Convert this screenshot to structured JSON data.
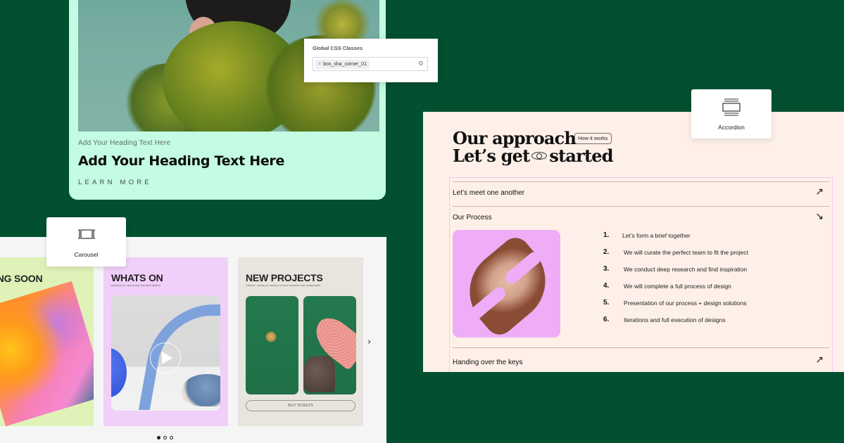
{
  "hero_card": {
    "subheading": "Add Your Heading Text Here",
    "heading": "Add Your Heading Text Here",
    "link": "LEARN MORE"
  },
  "css_classes_panel": {
    "label": "Global CSS Classes",
    "tags": [
      {
        "remove_icon": "×",
        "value": "box_sha_corner_01"
      }
    ],
    "settings_icon": "gear-icon"
  },
  "widgets": {
    "carousel": {
      "label": "Carousel",
      "icon": "carousel-icon"
    },
    "accordion": {
      "label": "Accordion",
      "icon": "accordion-icon"
    }
  },
  "carousel": {
    "slides": [
      {
        "title": "ING SOON"
      },
      {
        "title": "WHATS ON",
        "caption": "ENGAGE US • DISCOVER THE NEW DESIGN"
      },
      {
        "title": "NEW PROJECTS",
        "caption": "STREAM • PRODUCT DESIGN STUDIO REVIEWS AND INTERVIEWS",
        "button": "BUY TICKETS"
      }
    ],
    "next_label": "›",
    "dots": {
      "count": 3,
      "active": 0
    }
  },
  "approach": {
    "title_line1": "Our approach",
    "title_line2_a": "Let’s get",
    "title_line2_b": "started",
    "badge": "How it works",
    "accordion": [
      {
        "label": "Let’s meet one another",
        "arrow": "↗",
        "expanded": false
      },
      {
        "label": "Our Process",
        "arrow": "↘",
        "expanded": true
      },
      {
        "label": "Handing over the keys",
        "arrow": "↗",
        "expanded": false
      }
    ],
    "steps": [
      {
        "num": "1.",
        "text": "Let’s form a brief together"
      },
      {
        "num": "2.",
        "text": "We will curate the perfect team to fit the project"
      },
      {
        "num": "3.",
        "text": "We conduct deep research and find inspiration"
      },
      {
        "num": "4.",
        "text": "We will complete a full process of design"
      },
      {
        "num": "5.",
        "text": "Presentation of our process + design solutions"
      },
      {
        "num": "6.",
        "text": "Iterations and full execution of designs"
      }
    ]
  },
  "colors": {
    "background": "#02502f",
    "hero_card": "#c3fbe3",
    "approach_bg": "#fef0e8",
    "slide_green": "#dff2b8",
    "slide_pink": "#f0cff9",
    "slide_beige": "#e8e5df",
    "face_card": "#eeadf6"
  }
}
